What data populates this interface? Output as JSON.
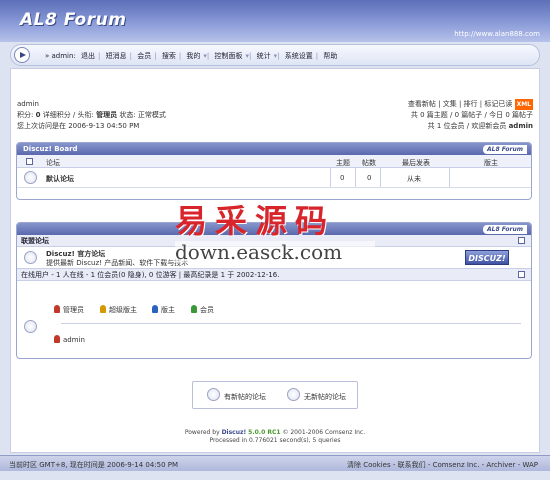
{
  "header": {
    "logo": "AL8 Forum",
    "site_url": "http://www.alan888.com"
  },
  "nav": {
    "prefix": "» admin:",
    "items": [
      "退出",
      "短消息",
      "会员",
      "搜索",
      "我的",
      "控制面板",
      "统计",
      "系统设置",
      "帮助"
    ]
  },
  "user": {
    "name": "admin",
    "stats_label": "积分:",
    "credits": "0",
    "credits_detail": "详细积分",
    "title_label": "头衔:",
    "title": "管理员",
    "status": "状态: 正常模式",
    "last_visit": "您上次访问是在 2006-9-13 04:50 PM"
  },
  "links": {
    "line1": [
      "查看新帖",
      "文集",
      "排行",
      "标记已读"
    ],
    "xml": "XML",
    "line2": "共 0 篇主题 / 0 篇帖子 / 今日 0 篇帖子",
    "line3_prefix": "共 1 位会员 / 欢迎新会员",
    "newest_member": "admin"
  },
  "board": {
    "title": "Discuz! Board",
    "tag": "AL8 Forum",
    "columns": [
      "论坛",
      "主题",
      "帖数",
      "最后发表",
      "版主"
    ],
    "forums": [
      {
        "name": "默认论坛",
        "threads": "0",
        "posts": "0",
        "last": "从未",
        "mods": ""
      }
    ]
  },
  "second_box": {
    "tag": "AL8 Forum",
    "league_title": "联盟论坛",
    "league_name": "Discuz! 官方论坛",
    "league_desc": "提供最新 Discuz! 产品新闻、软件下载与技术",
    "league_logo": "DISCUZ!",
    "online_title": "在线用户 - 1 人在线 - 1 位会员(0 隐身), 0 位游客 | 最高纪录是 1 于 2002-12-16.",
    "legend": [
      "管理员",
      "超级版主",
      "版主",
      "会员"
    ],
    "online_user": "admin"
  },
  "watermark": {
    "cn": "易采源码",
    "en": "down.easck.com"
  },
  "legend_box": {
    "new": "有新帖的论坛",
    "none": "无新帖的论坛"
  },
  "footer": {
    "powered_by": "Powered by",
    "product": "Discuz!",
    "version": "5.0.0 RC1",
    "copyright": "© 2001-2006 Comsenz Inc.",
    "processed": "Processed in 0.776021 second(s), 5 queries"
  },
  "statusbar": {
    "left": "当前时区 GMT+8, 现在时间是 2006-9-14 04:50 PM",
    "right": "清除 Cookies - 联系我们 - Comsenz Inc. - Archiver - WAP"
  },
  "colors": {
    "header": "#5c6fb8",
    "accent": "#f60",
    "watermark": "#d8252b"
  }
}
